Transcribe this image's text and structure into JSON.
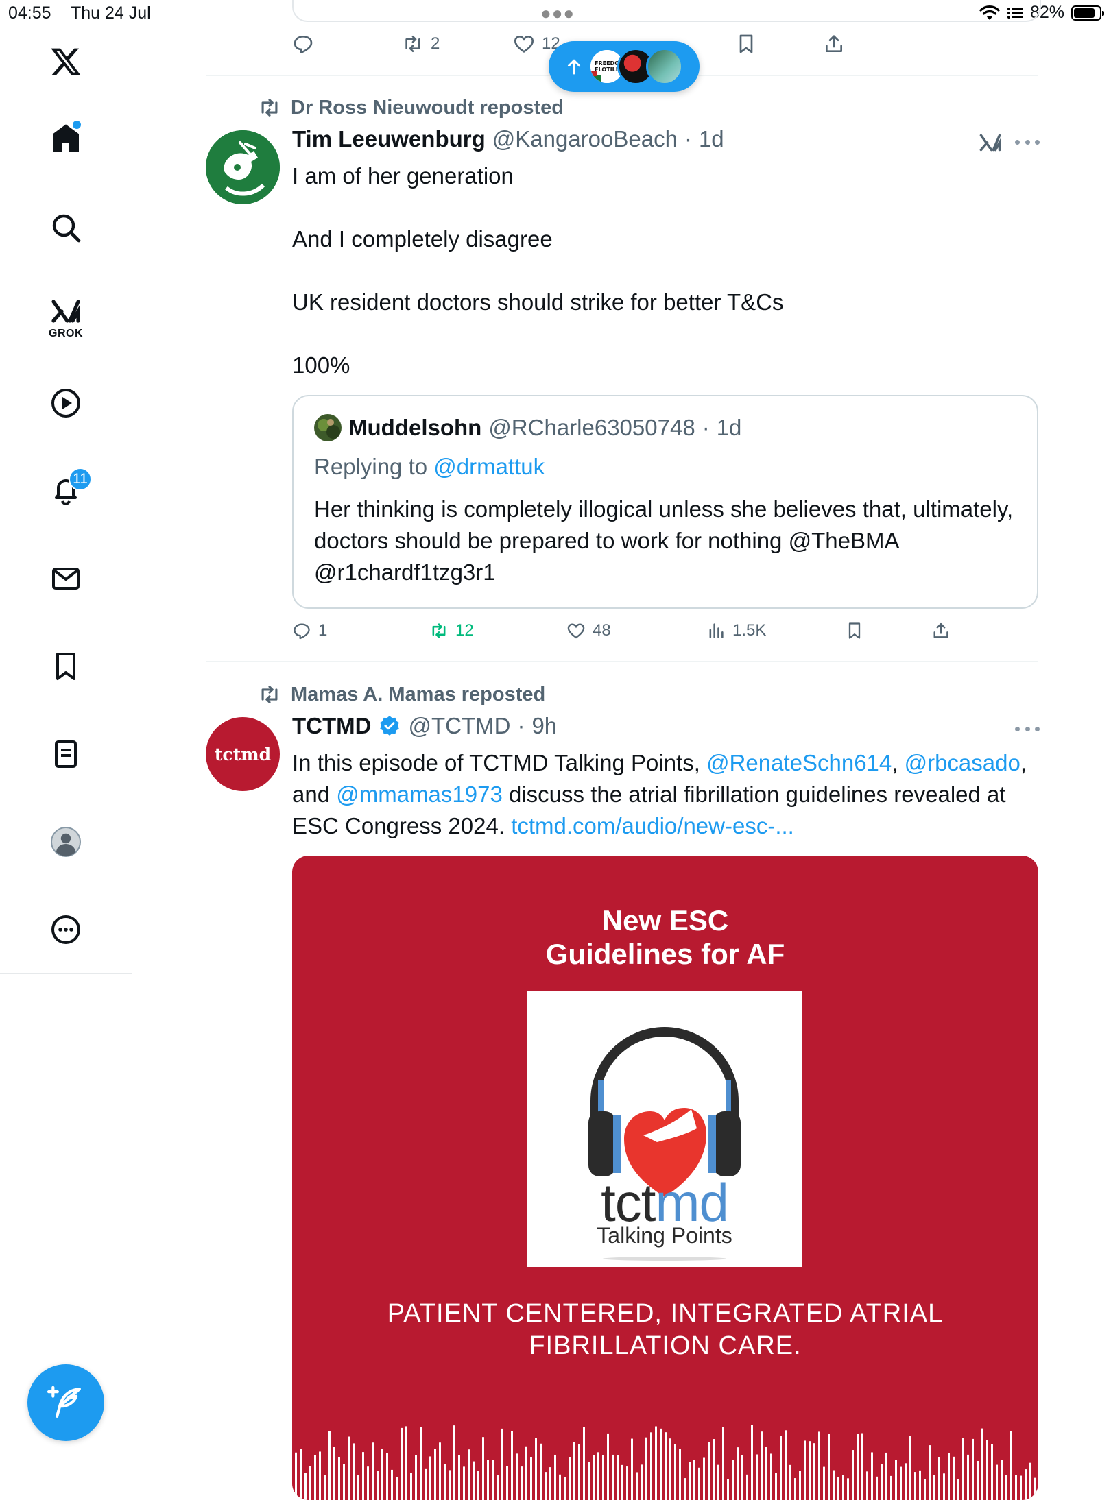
{
  "status_bar": {
    "time": "04:55",
    "date": "Thu 24 Jul",
    "battery": "82%",
    "battery_level": 0.82
  },
  "sidebar": {
    "grok_label": "GROK",
    "notifications_count": "11"
  },
  "prev_tweet": {
    "retweets": "2",
    "likes": "12"
  },
  "tweet1": {
    "repost_by": "Dr Ross Nieuwoudt reposted",
    "name": "Tim Leeuwenburg",
    "handle": "@KangarooBeach",
    "sep": "·",
    "time": "1d",
    "lines": [
      "I am of her generation",
      "And I completely disagree",
      "UK resident doctors should strike for better T&Cs",
      "100%"
    ],
    "quote": {
      "name": "Muddelsohn",
      "handle": "@RCharle63050748",
      "sep": "·",
      "time": "1d",
      "replying_prefix": "Replying to",
      "replying_to": "@drmattuk",
      "text": "Her thinking is completely illogical unless she believes that, ultimately, doctors should be prepared to work for nothing @TheBMA @r1chardf1tzg3r1"
    },
    "stats": {
      "replies": "1",
      "retweets": "12",
      "likes": "48",
      "views": "1.5K"
    }
  },
  "tweet2": {
    "repost_by": "Mamas A. Mamas reposted",
    "avatar_text": "tctmd",
    "name": "TCTMD",
    "handle": "@TCTMD",
    "sep": "·",
    "time": "9h",
    "text_1": "In this episode of TCTMD Talking Points,",
    "mention_1": "@RenateSchn614",
    "text_2": ",",
    "mention_2": "@rbcasado",
    "text_3": ", and",
    "mention_3": "@mmamas1973",
    "text_4": "discuss the atrial fibrillation guidelines revealed at ESC Congress 2024.",
    "link": "tctmd.com/audio/new-esc-...",
    "media": {
      "title_line1": "New ESC",
      "title_line2": "Guidelines for AF",
      "logo_word_a": "tct",
      "logo_word_b": "md",
      "logo_sub": "Talking Points",
      "caption_line1": "PATIENT CENTERED, INTEGRATED ATRIAL",
      "caption_line2": "FIBRILLATION CARE."
    }
  },
  "colors": {
    "accent": "#1d9bf0",
    "retweet_green": "#00ba7c",
    "tctmd_red": "#b81a30",
    "text": "#0f1419",
    "muted": "#536471"
  },
  "pill_avatar_text": {
    "a": "FREEDO",
    "b": "FLOTILL"
  }
}
